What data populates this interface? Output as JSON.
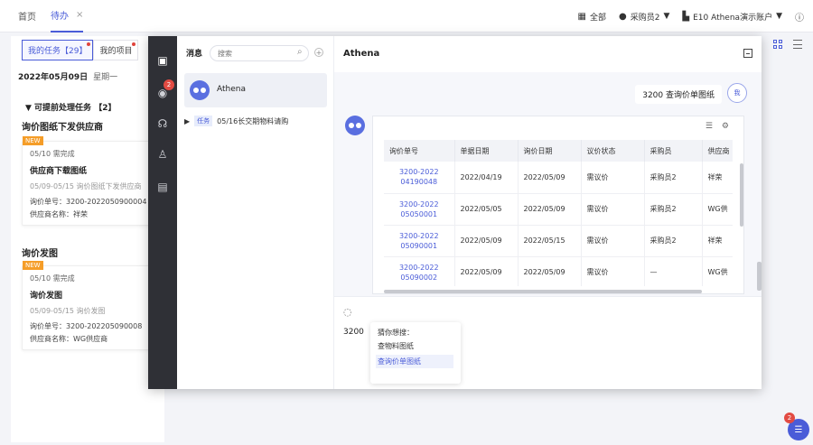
{
  "topbar": {
    "tabs": [
      {
        "label": "首页"
      },
      {
        "label": "待办"
      }
    ],
    "close_glyph": "×",
    "scope": "全部",
    "user": "采购员2",
    "tenant": "E10 Athena演示账户",
    "dropdown_glyph": "▼",
    "icons": {
      "scope": "grid-icon",
      "user": "user-icon",
      "tenant": "building-icon",
      "help": "help-icon"
    }
  },
  "workbench": {
    "segments": [
      {
        "label": "我的任务【29】"
      },
      {
        "label": "我的项目"
      }
    ],
    "date": "2022年05月09日",
    "weekday": "星期一",
    "section_toggle": "▼ 可提前处理任务 【2】",
    "groups": [
      {
        "title": "询价图纸下发供应商",
        "card": {
          "tag": "NEW",
          "status": "05/10 需完成",
          "title": "供应商下载图纸",
          "sub": "05/09-05/15 询价图纸下发供应商",
          "kv1": "询价单号：3200-2022050900004",
          "kv2": "供应商名称：祥荣"
        }
      },
      {
        "title": "询价发图",
        "card": {
          "tag": "NEW",
          "status": "05/10 需完成",
          "title": "询价发图",
          "sub": "05/09-05/15 询价发图",
          "kv1": "询价单号：3200-202205090008",
          "kv2": "供应商名称：WG供应商"
        }
      }
    ]
  },
  "rail": {
    "icons": [
      "chat-icon",
      "bot-icon",
      "headset-icon",
      "contacts-icon",
      "report-icon"
    ],
    "badge": "2"
  },
  "messages": {
    "heading": "消息",
    "search_placeholder": "搜索",
    "plus": "+",
    "conversation": {
      "name": "Athena"
    },
    "task": {
      "arrow": "▶",
      "tag": "任务",
      "text": "05/16长交期物料请购"
    }
  },
  "chat": {
    "title": "Athena",
    "user_message": "3200 查询价单图纸",
    "me_avatar": "我",
    "table": {
      "columns": [
        "询价单号",
        "单据日期",
        "询价日期",
        "议价状态",
        "采购员",
        "供应商"
      ],
      "rows": [
        [
          "3200-2022 04190048",
          "2022/04/19",
          "2022/05/09",
          "需议价",
          "采购员2",
          "祥荣"
        ],
        [
          "3200-2022 05050001",
          "2022/05/05",
          "2022/05/09",
          "需议价",
          "采购员2",
          "WG供"
        ],
        [
          "3200-2022 05090001",
          "2022/05/09",
          "2022/05/15",
          "需议价",
          "采购员2",
          "祥荣"
        ],
        [
          "3200-2022 05090002",
          "2022/05/09",
          "2022/05/09",
          "需议价",
          "—",
          "WG供"
        ]
      ]
    },
    "input": {
      "text": "3200",
      "suggest_title": "猜你想搜：",
      "suggest_1": "查物料图纸",
      "suggest_2": "查询价单图纸"
    }
  },
  "fab": {
    "badge": "2"
  },
  "colors": {
    "accent": "#4a5cd8",
    "rail": "#2f3036",
    "badge": "#e24b43",
    "new_tag": "#f59d28"
  }
}
